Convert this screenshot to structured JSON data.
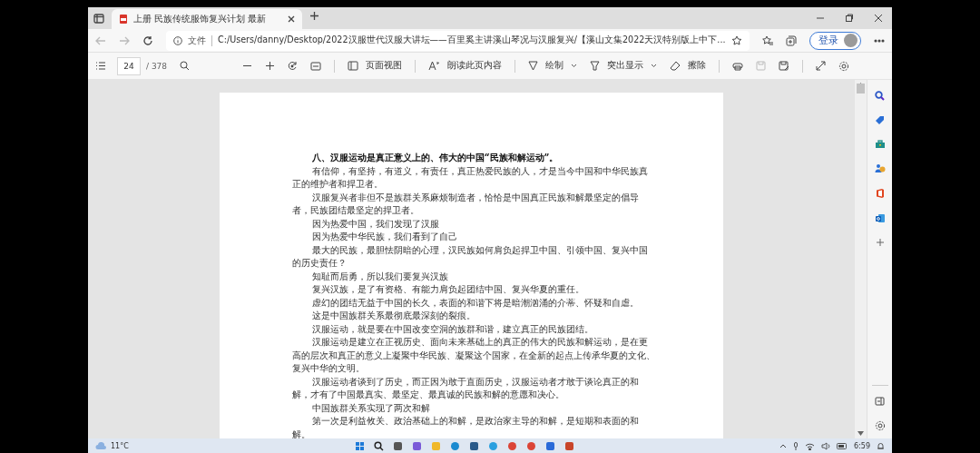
{
  "tabs": [
    {
      "title": "上册 民族传统服饰复兴计划 最新",
      "selected": true
    }
  ],
  "address_bar": {
    "scheme": "文件",
    "url": "C:/Users/danny/Desktop/2022汉服世代汉服大讲坛——百里奚主讲溪山琴况与汉服复兴/【溪山文集2022天汉特别版上中下..."
  },
  "profile": {
    "sign_in": "登录"
  },
  "pdf_toolbar": {
    "page": "24",
    "page_count": "/ 378",
    "tools": [
      {
        "label": "页面视图",
        "dropdown": false
      },
      {
        "label": "朗读此页内容",
        "dropdown": false
      },
      {
        "label": "绘制",
        "dropdown": true
      },
      {
        "label": "突出显示",
        "dropdown": true
      },
      {
        "label": "擦除",
        "dropdown": false
      }
    ]
  },
  "document": {
    "heading": "八、汉服运动是真正意义上的、伟大的中国“民族和解运动”。",
    "paragraphs": [
      "有信仰，有坚持，有道义，有责任，真正热爱民族的人，才是当今中国和中华民族真正的维护者和捍卫者。",
      "汉服复兴者非但不是族群关系麻烦制造者，恰恰是中国真正民族和解最坚定的倡导者，民族团结最坚定的捍卫者。",
      "因为热爱中国，我们发现了汉服",
      "因为热爱中华民族，我们看到了自己",
      "最大的民族，最胆怯阴暗的心理，汉民族如何肩负起捍卫中国、引领中国、复兴中国的历史责任？",
      "知耻而后勇，所以我们要复兴汉族",
      "复兴汉族，是了有资格、有能力肩负起团结中国、复兴华夏的重任。",
      "虚幻的团结无益于中国的长久，表面的和谐下将是暗潮汹涌的介蒂、怀疑和自虐。",
      "这是中国族群关系最彻底最深刻的裂痕。",
      "汉服运动，就是要在中国改变空洞的族群和谐，建立真正的民族团结。",
      "汉服运动是建立在正视历史、面向未来基础上的真正的伟大的民族和解运动，是在更高的层次和真正的意义上凝聚中华民族、凝聚这个国家，在全新的起点上传承华夏的文化、复兴中华的文明。",
      "汉服运动者谈到了历史，而正因为敢于直面历史，汉服运动者才敢于谈论真正的和解，才有了中国最真实、最坚定、最真诚的民族和解的意愿和决心。",
      "中国族群关系实现了两次和解",
      "第一次是利益攸关、政治基础上的和解，是政治家主导的和解，是短期和表面的和解。"
    ]
  },
  "taskbar": {
    "temperature": "11°C",
    "time": "6:59"
  }
}
